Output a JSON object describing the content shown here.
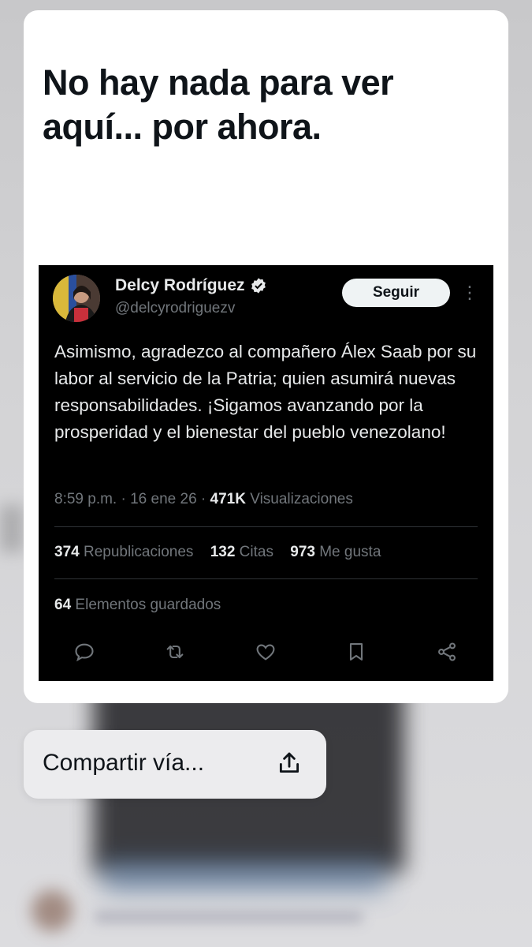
{
  "colors": {
    "card_bg": "#ffffff",
    "tweet_bg": "#000000",
    "text_primary": "#e7e9ea",
    "text_secondary": "#71767b",
    "follow_bg": "#eff3f4"
  },
  "card": {
    "headline": "No hay nada para ver aquí... por ahora."
  },
  "tweet": {
    "author_name": "Delcy Rodríguez",
    "handle": "@delcyrodriguezv",
    "follow_label": "Seguir",
    "more_icon": "more-vertical-icon",
    "verified_icon": "verified-badge-icon",
    "text": "Asimismo, agradezco al compañero Álex Saab por su labor al servicio de la Patria; quien asumirá nuevas responsabilidades. ¡Sigamos avanzando por la prosperidad y el bienestar del pueblo venezolano!",
    "time": "8:59 p.m.",
    "date": "16 ene 26",
    "views_count": "471K",
    "views_label": "Visualizaciones",
    "reposts_count": "374",
    "reposts_label": "Republicaciones",
    "quotes_count": "132",
    "quotes_label": "Citas",
    "likes_count": "973",
    "likes_label": "Me gusta",
    "bookmarks_count": "64",
    "bookmarks_label": "Elementos guardados",
    "actions": [
      "reply-icon",
      "repost-icon",
      "like-icon",
      "bookmark-icon",
      "share-icon"
    ]
  },
  "share_menu": {
    "label": "Compartir vía...",
    "icon": "share-upload-icon"
  }
}
